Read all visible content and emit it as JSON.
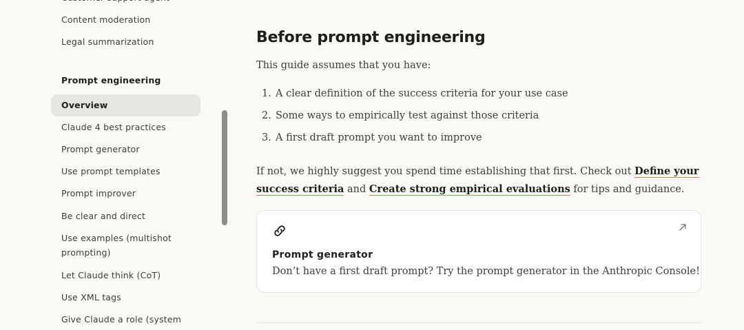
{
  "sidebar": {
    "top_items": [
      {
        "label": "Customer support agent"
      },
      {
        "label": "Content moderation"
      },
      {
        "label": "Legal summarization"
      }
    ],
    "section_title": "Prompt engineering",
    "items": [
      {
        "label": "Overview",
        "active": true
      },
      {
        "label": "Claude 4 best practices"
      },
      {
        "label": "Prompt generator"
      },
      {
        "label": "Use prompt templates"
      },
      {
        "label": "Prompt improver"
      },
      {
        "label": "Be clear and direct"
      },
      {
        "label": "Use examples (multishot prompting)"
      },
      {
        "label": "Let Claude think (CoT)"
      },
      {
        "label": "Use XML tags"
      },
      {
        "label": "Give Claude a role (system"
      }
    ]
  },
  "main": {
    "heading": "Before prompt engineering",
    "intro": "This guide assumes that you have:",
    "list": [
      {
        "num": "1.",
        "text": "A clear definition of the success criteria for your use case"
      },
      {
        "num": "2.",
        "text": "Some ways to empirically test against those criteria"
      },
      {
        "num": "3.",
        "text": "A first draft prompt you want to improve"
      }
    ],
    "para": {
      "before": "If not, we highly suggest you spend time establishing that first. Check out ",
      "link1": "Define your success criteria",
      "middle": " and ",
      "link2": "Create strong empirical evaluations",
      "after": " for tips and guidance."
    },
    "card": {
      "icon": "link-icon",
      "arrow": "arrow-up-right-icon",
      "title": "Prompt generator",
      "description": "Don’t have a first draft prompt? Try the prompt generator in the Anthropic Console!"
    }
  },
  "colors": {
    "background": "#faf9f5",
    "active_item": "#e6e5df",
    "link_underline": "#d97757",
    "scrollbar": "#8e8d89"
  }
}
